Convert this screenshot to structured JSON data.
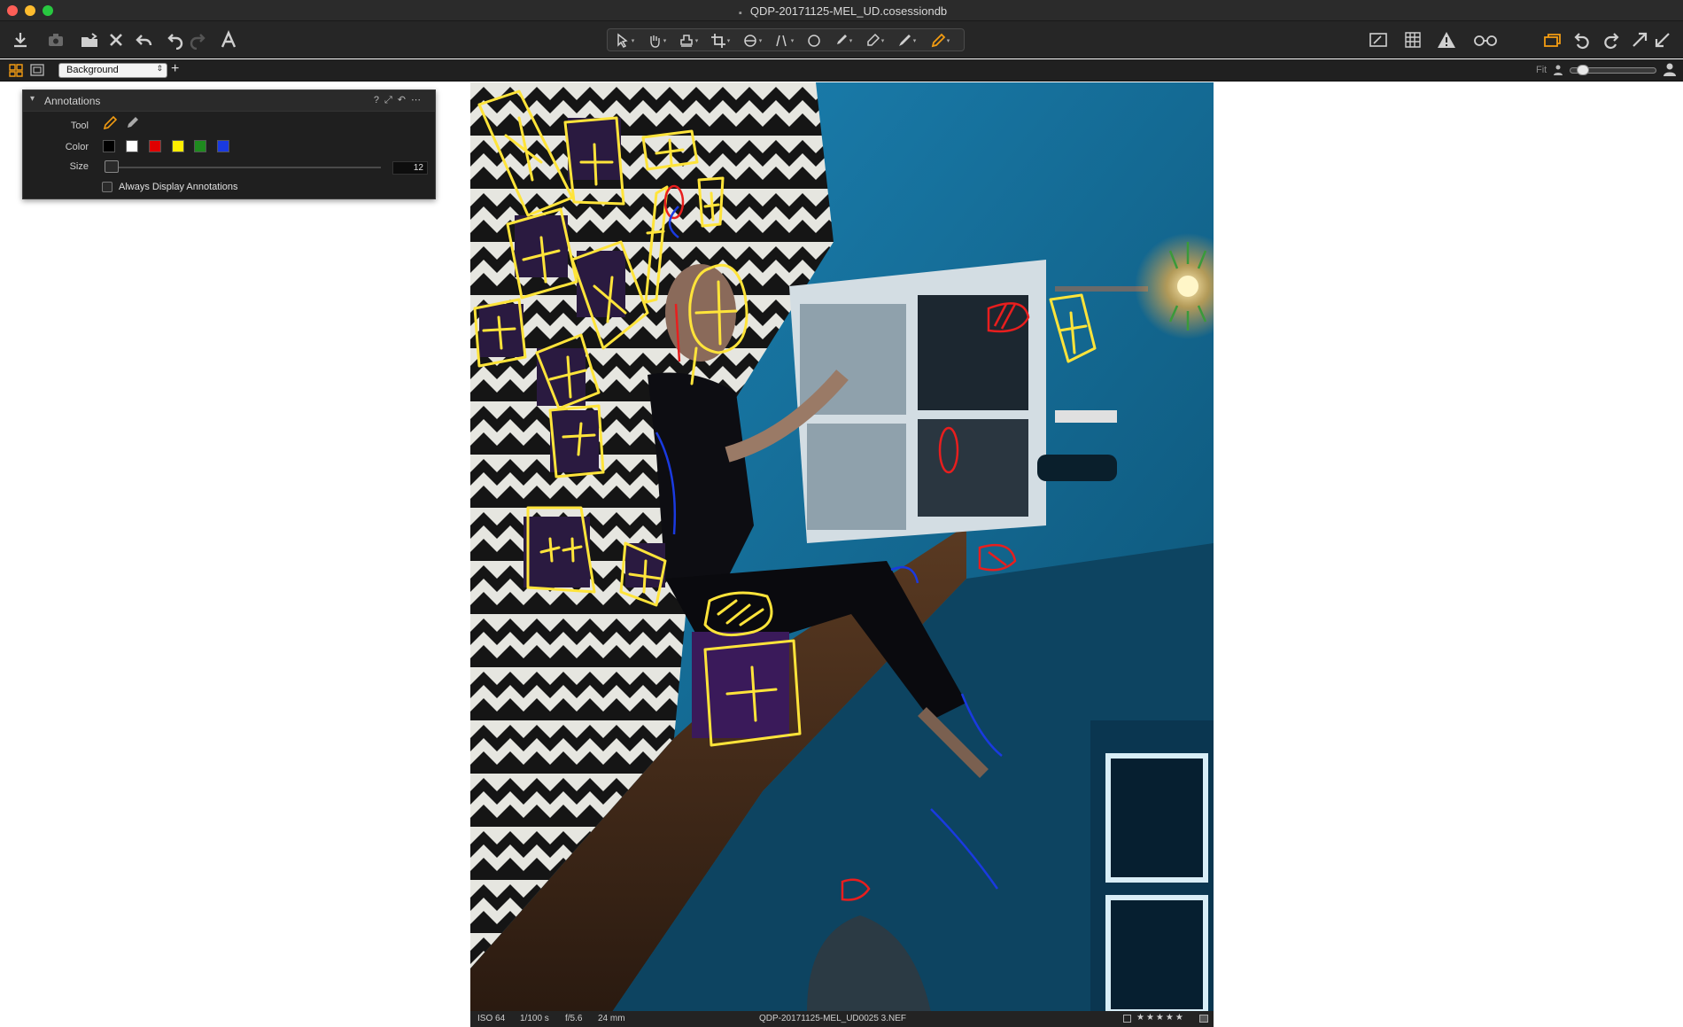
{
  "window": {
    "title": "QDP-20171125-MEL_UD.cosessiondb"
  },
  "toolbar": {
    "left_icons": [
      "import-icon",
      "camera-icon",
      "folder-move-icon",
      "delete-icon",
      "undo-back-icon",
      "undo-icon",
      "redo-icon",
      "text-icon"
    ],
    "cursor_tools": [
      "select-icon",
      "pan-icon",
      "stamp-icon",
      "crop-icon",
      "rotate-icon",
      "keystone-icon",
      "circle-icon",
      "brush-icon",
      "eraser-icon",
      "picker-icon",
      "annotate-pen-icon"
    ],
    "right_icons": [
      "edit-image-icon",
      "grid-icon",
      "warning-icon",
      "glasses-icon",
      "layers-icon",
      "rotate-left-icon",
      "rotate-right-icon",
      "expand-icon",
      "collapse-icon"
    ],
    "accent": "#f39c12"
  },
  "subbar": {
    "layer_name": "Background",
    "add_layer": "+",
    "fit_label": "Fit"
  },
  "annotations_panel": {
    "title": "Annotations",
    "tool_label": "Tool",
    "color_label": "Color",
    "size_label": "Size",
    "size_value": "12",
    "colors": [
      "#000000",
      "#ffffff",
      "#e00000",
      "#ffee00",
      "#1e8a1e",
      "#1a3ae0"
    ],
    "always_display_label": "Always Display Annotations",
    "always_display_checked": false
  },
  "status": {
    "iso": "ISO 64",
    "shutter": "1/100 s",
    "aperture": "f/5.6",
    "focal": "24 mm",
    "filename": "QDP-20171125-MEL_UD0025 3.NEF",
    "rating_stars": "★★★★★"
  }
}
